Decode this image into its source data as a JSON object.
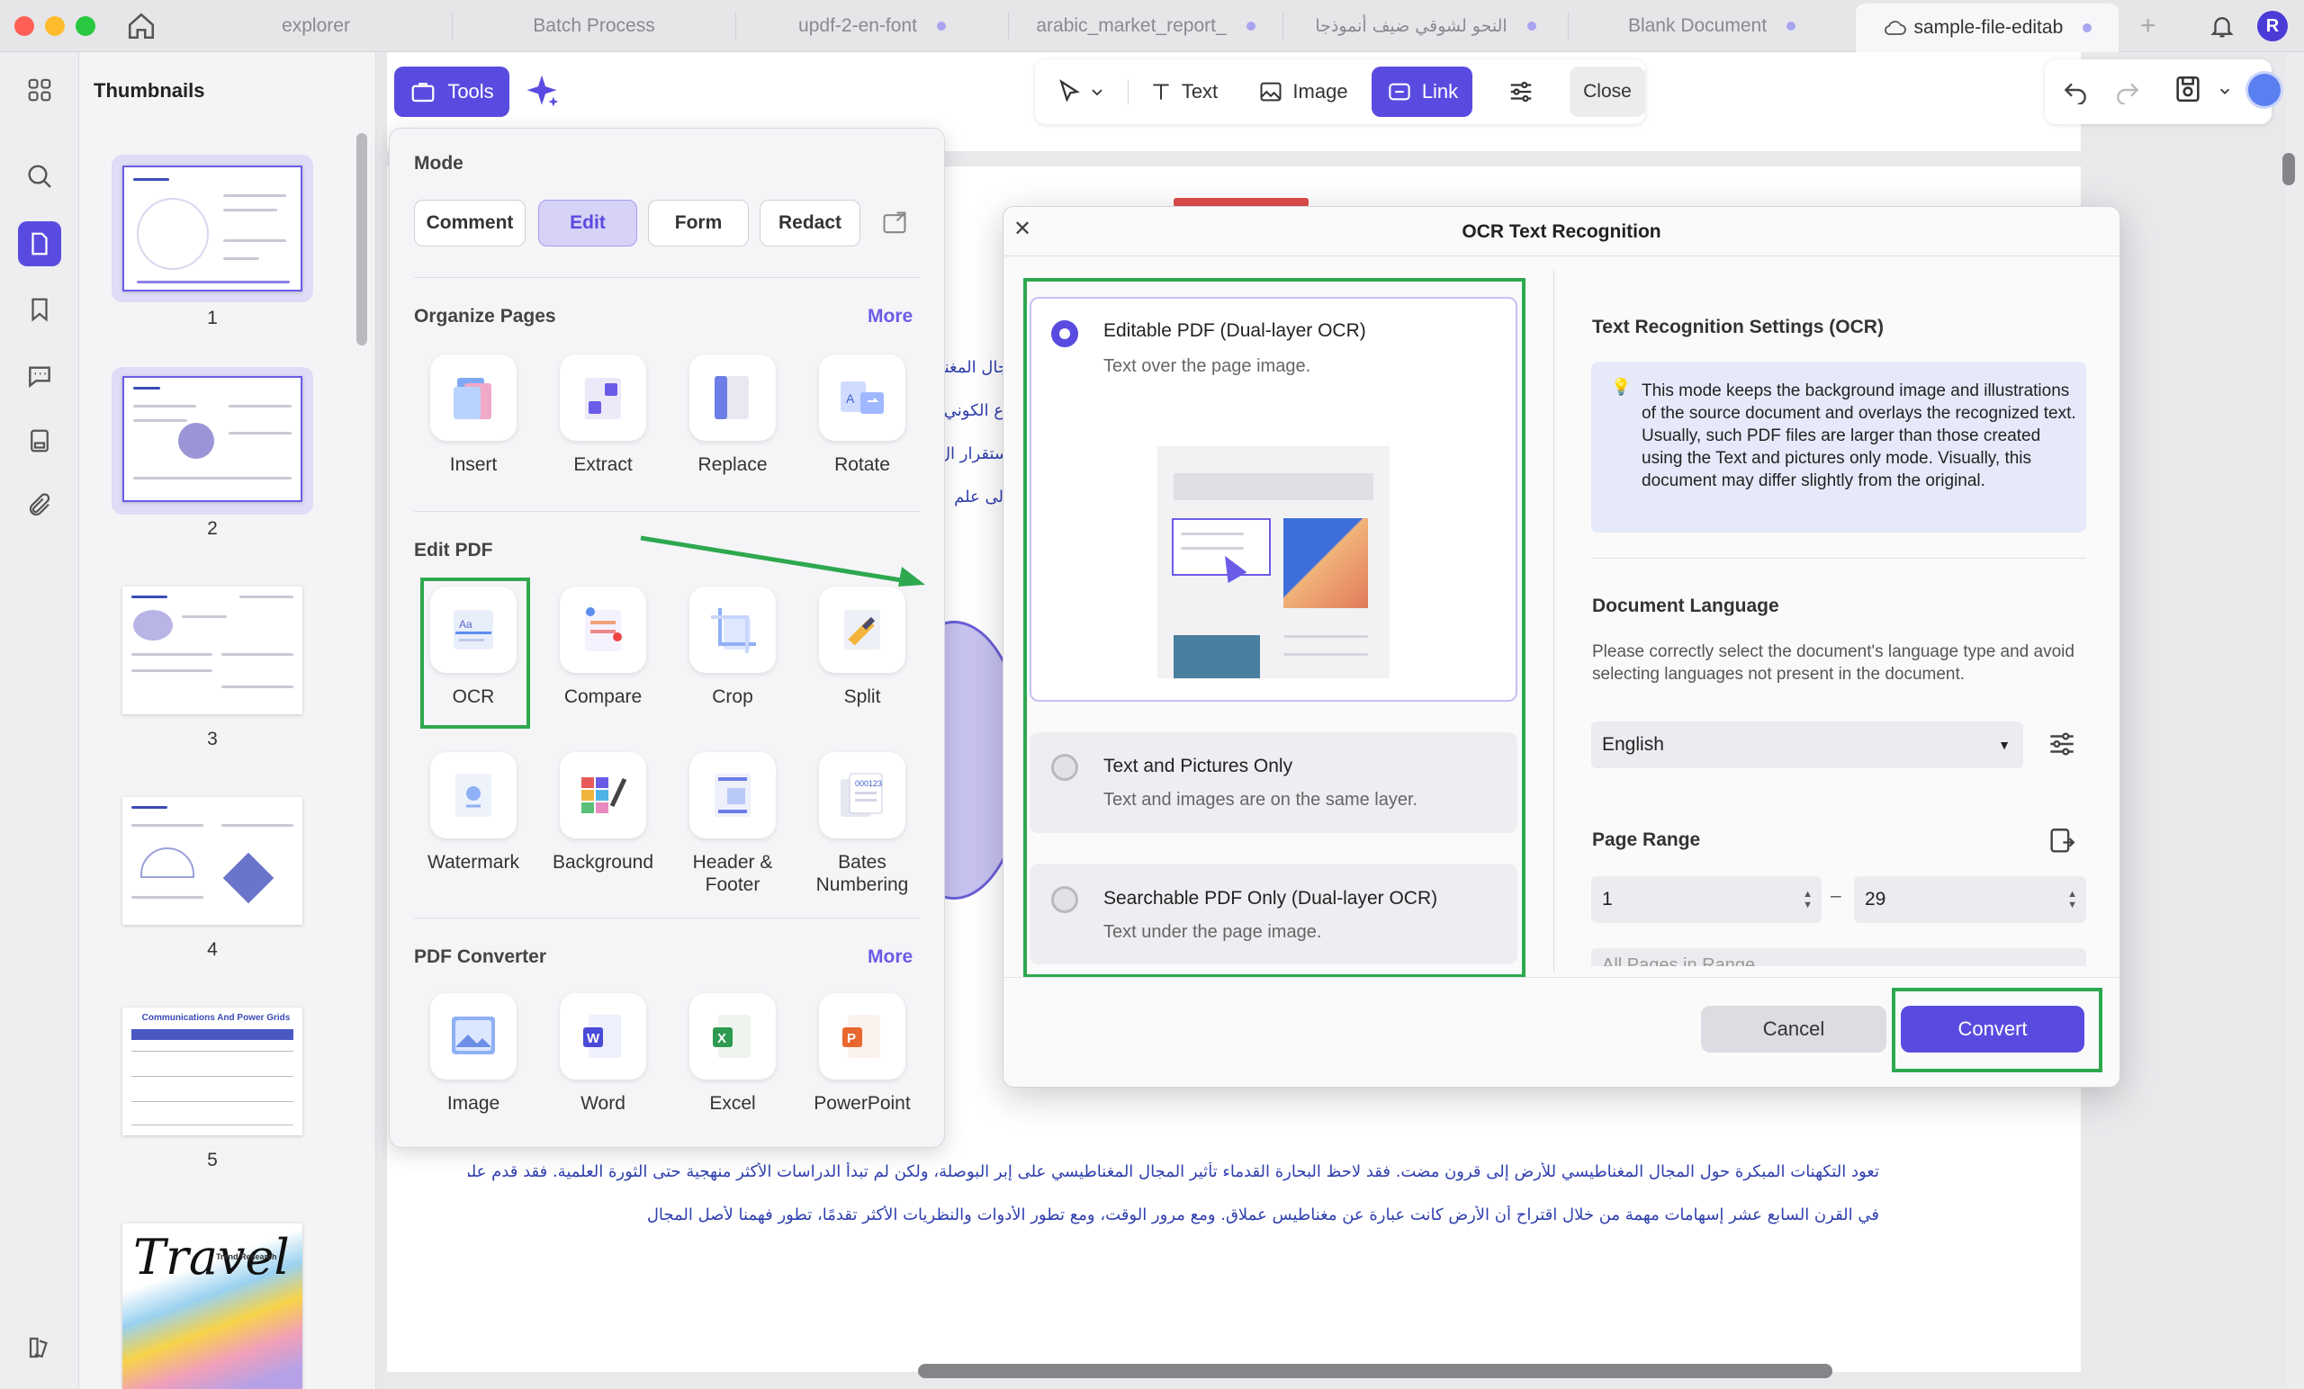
{
  "tabs": [
    "explorer",
    "Batch Process",
    "updf-2-en-font",
    "arabic_market_report_",
    "النحو لشوقي ضيف أنموذجا",
    "Blank Document",
    "sample-file-editab"
  ],
  "user_avatar": "R",
  "thumbnails": {
    "title": "Thumbnails",
    "pages": [
      "1",
      "2",
      "3",
      "4",
      "5"
    ],
    "page5_cover_word": "Travel",
    "page5_subtitle": "Trend Research",
    "page5_table_title": "Communications And Power Grids"
  },
  "toolbar": {
    "tools": "Tools",
    "text": "Text",
    "image": "Image",
    "link": "Link",
    "close": "Close"
  },
  "tools_panel": {
    "mode_title": "Mode",
    "modes": [
      "Comment",
      "Edit",
      "Form",
      "Redact"
    ],
    "organize_title": "Organize Pages",
    "organize_more": "More",
    "organize": [
      "Insert",
      "Extract",
      "Replace",
      "Rotate"
    ],
    "edit_title": "Edit PDF",
    "edit": [
      "OCR",
      "Compare",
      "Crop",
      "Split"
    ],
    "edit2": [
      "Watermark",
      "Background",
      "Header & Footer",
      "Bates Numbering"
    ],
    "converter_title": "PDF Converter",
    "converter_more": "More",
    "converter": [
      "Image",
      "Word",
      "Excel",
      "PowerPoint"
    ]
  },
  "dialog": {
    "title": "OCR Text Recognition",
    "options": [
      {
        "title": "Editable PDF (Dual-layer OCR)",
        "sub": "Text over the page image."
      },
      {
        "title": "Text and Pictures Only",
        "sub": "Text and images are on the same layer."
      },
      {
        "title": "Searchable PDF Only (Dual-layer OCR)",
        "sub": "Text under the page image."
      }
    ],
    "settings_title": "Text Recognition Settings (OCR)",
    "info": "This mode keeps the background image and illustrations of the source document and overlays the recognized text. Usually, such PDF files are larger than those created using the Text and pictures only mode. Visually, this document may differ slightly from the original.",
    "lang_title": "Document Language",
    "lang_desc": "Please correctly select the document's language type and avoid selecting languages not present in the document.",
    "lang_value": "English",
    "range_title": "Page Range",
    "range_from": "1",
    "range_to": "29",
    "range_dash": "–",
    "range_select": "All Pages in Range",
    "cancel": "Cancel",
    "convert": "Convert"
  },
  "doc_text": {
    "line1": "تعود التكهنات المبكرة حول المجال المغناطيسي للأرض إلى قرون مضت. فقد لاحظ البحارة القدماء تأثير المجال المغناطيسي على إبر البوصلة، ولكن لم تبدأ الدراسات الأكثر منهجية حتى الثورة العلمية. فقد قدم علماء مثل وليام جيلبرت",
    "line2": "في القرن السابع عشر إسهامات مهمة من خلال اقتراح أن الأرض كانت عبارة عن مغناطيس عملاق. ومع مرور الوقت، ومع تطور الأدوات والنظريات الأكثر تقدمًا، تطور فهمنا لأصل المجال المغناطيسي",
    "frag1": "جال المغنا",
    "frag2": "اع الكوني",
    "frag3": "ستقرار ال",
    "frag4": "إلى علم"
  },
  "colors": {
    "accent": "#6b5ce7",
    "highlight": "#2ea84f"
  }
}
